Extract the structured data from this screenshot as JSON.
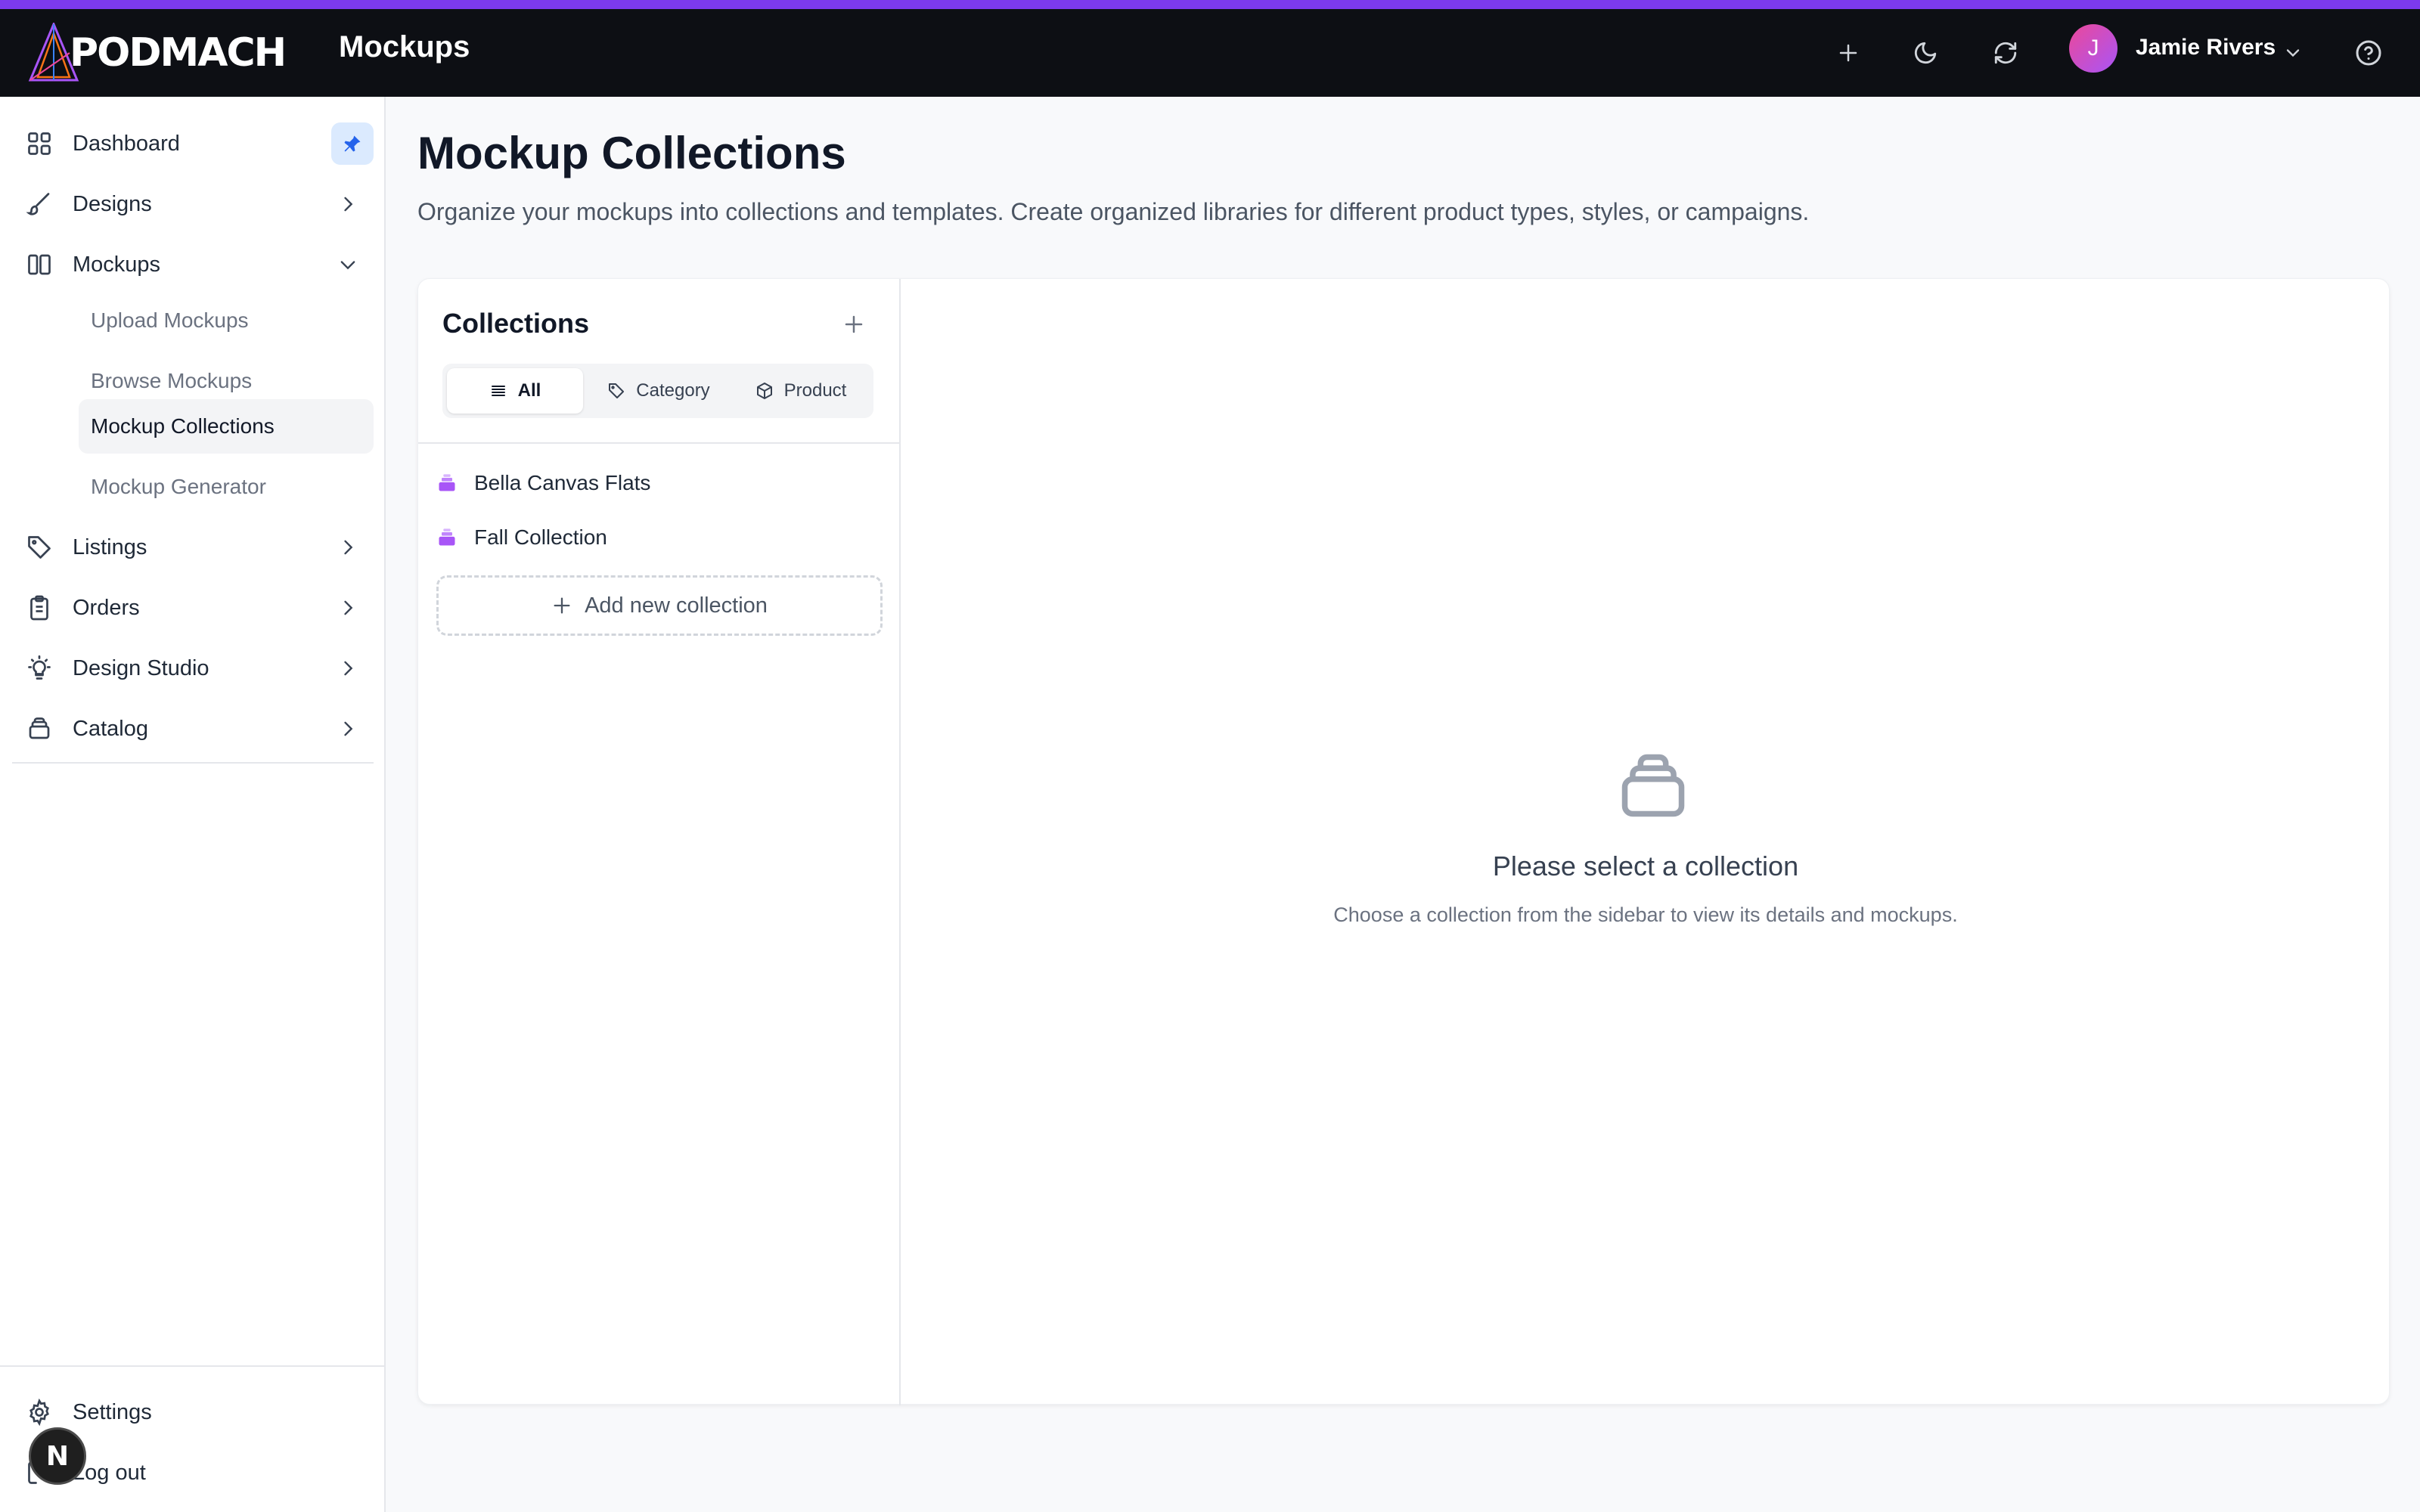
{
  "colors": {
    "accent": "#7c3aed",
    "topbar_bg": "#0d0f14",
    "collection_icon": "#a855f7",
    "pin_bg": "#dbeafe"
  },
  "header": {
    "logo_text": "PODMACH",
    "title": "Mockups",
    "user": {
      "initial": "J",
      "name": "Jamie Rivers"
    },
    "icons": [
      "plus-icon",
      "moon-icon",
      "refresh-icon",
      "chevron-down-icon",
      "help-icon"
    ]
  },
  "sidebar": {
    "items": [
      {
        "label": "Dashboard",
        "icon": "grid-icon"
      },
      {
        "label": "Designs",
        "icon": "brush-icon"
      },
      {
        "label": "Mockups",
        "icon": "columns-icon",
        "expanded": true
      },
      {
        "label": "Listings",
        "icon": "tag-icon"
      },
      {
        "label": "Orders",
        "icon": "clipboard-icon"
      },
      {
        "label": "Design Studio",
        "icon": "lightbulb-icon"
      },
      {
        "label": "Catalog",
        "icon": "layers-icon"
      }
    ],
    "mockups_sub": [
      "Upload Mockups",
      "Browse Mockups",
      "Mockup Collections",
      "Mockup Generator"
    ],
    "active_sub": "Mockup Collections",
    "bottom": [
      {
        "label": "Settings",
        "icon": "gear-icon"
      },
      {
        "label": "Log out",
        "icon": "logout-icon"
      }
    ],
    "badge": "N"
  },
  "main": {
    "title": "Mockup Collections",
    "subtitle": "Organize your mockups into collections and templates. Create organized libraries for different product types, styles, or campaigns.",
    "collections": {
      "title": "Collections",
      "filters": [
        "All",
        "Category",
        "Product"
      ],
      "active_filter": "All",
      "items": [
        "Bella Canvas Flats",
        "Fall Collection"
      ],
      "add_label": "Add new collection"
    },
    "empty": {
      "title": "Please select a collection",
      "text": "Choose a collection from the sidebar to view its details and mockups."
    }
  }
}
